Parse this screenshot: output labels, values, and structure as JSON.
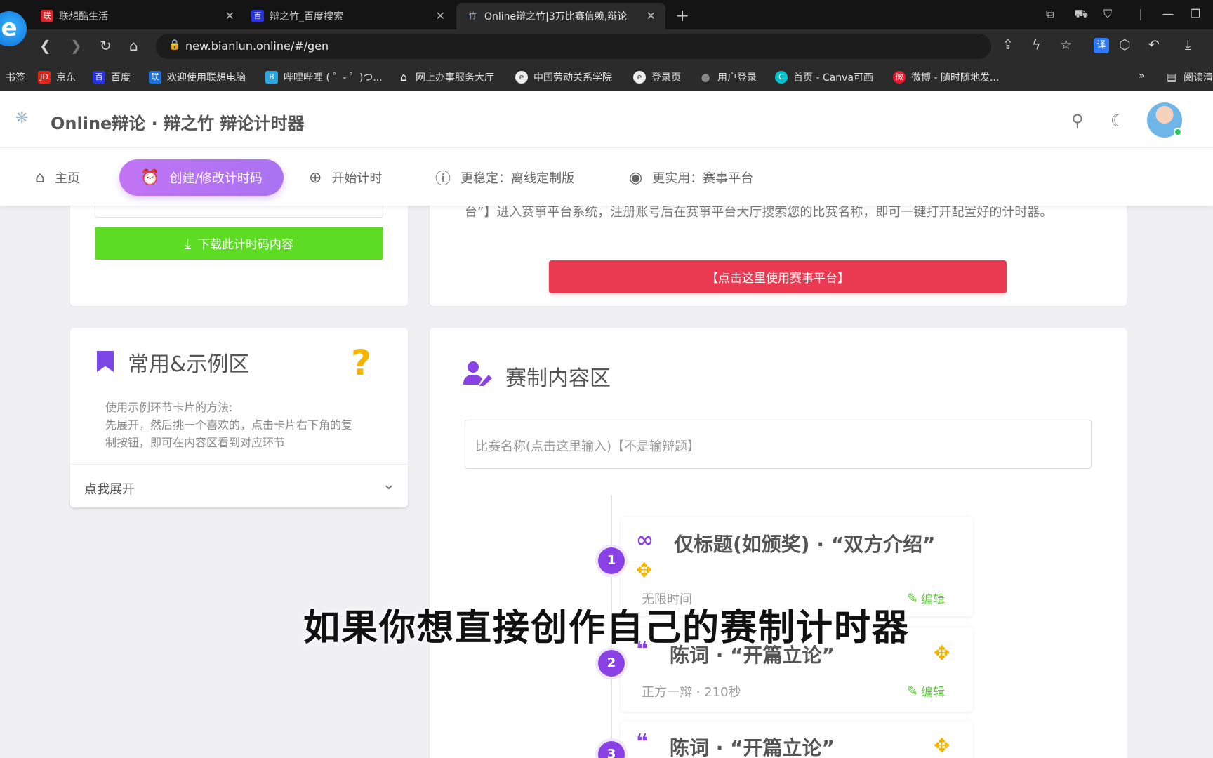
{
  "browser": {
    "tabs": [
      {
        "title": "联想酷生活",
        "favicon": "联"
      },
      {
        "title": "辩之竹_百度搜索",
        "favicon": "百"
      },
      {
        "title": "Online辩之竹|3万比赛信赖,辩论",
        "favicon": "竹"
      }
    ],
    "url": "new.bianlun.online/#/gen",
    "ext_label": "译",
    "bookmarks": [
      {
        "label": "书签"
      },
      {
        "label": "京东",
        "icon": "JD",
        "color": "#e1251b"
      },
      {
        "label": "百度",
        "icon": "百",
        "color": "#2932e1"
      },
      {
        "label": "欢迎使用联想电脑",
        "icon": "联",
        "color": "#1e6fd9"
      },
      {
        "label": "哔哩哔哩 ( ゜- ゜)つ...",
        "icon": "B",
        "color": "#2aa6e0"
      },
      {
        "label": "网上办事服务大厅",
        "icon": "⌂",
        "color": "#666"
      },
      {
        "label": "中国劳动关系学院",
        "icon": "e",
        "color": "#444"
      },
      {
        "label": "登录页",
        "icon": "e",
        "color": "#444"
      },
      {
        "label": "用户登录",
        "icon": "●",
        "color": "#555"
      },
      {
        "label": "首页 - Canva可画",
        "icon": "C",
        "color": "#00c4cc"
      },
      {
        "label": "微博 - 随时随地发...",
        "icon": "微",
        "color": "#e6162d"
      }
    ],
    "bookmarks_more": "»",
    "reader": "阅读清"
  },
  "site": {
    "title": "Online辩论 · 辩之竹 辩论计时器",
    "nav": [
      {
        "label": "主页",
        "icon": "home-icon"
      },
      {
        "label": "创建/修改计时码",
        "icon": "alarm-plus-icon"
      },
      {
        "label": "开始计时",
        "icon": "login-icon"
      },
      {
        "label": "更稳定：离线定制版",
        "icon": "info-circle-icon"
      },
      {
        "label": "更实用：赛事平台",
        "icon": "platform-icon"
      }
    ]
  },
  "main": {
    "download_label": "下载此计时码内容",
    "platform_desc": "台”】进入赛事平台系统，注册账号后在赛事平台大厅搜索您的比赛名称，即可一键打开配置好的计时器。",
    "platform_button": "【点击这里使用赛事平台】",
    "examples": {
      "title": "常用&示例区",
      "qmark": "?",
      "usage_lines": [
        "使用示例环节卡片的方法:",
        "先展开，然后挑一个喜欢的，点击卡片右下角的复",
        "制按钮，即可在内容区看到对应环节"
      ],
      "expand_label": "点我展开"
    },
    "content": {
      "title": "赛制内容区",
      "match_placeholder": "比赛名称(点击这里输入)【不是输辩题】",
      "items": [
        {
          "num": "1",
          "title": "仅标题(如颁奖) · “双方介绍”",
          "sub": "无限时间",
          "edit": "编辑"
        },
        {
          "num": "2",
          "title": "陈词 · “开篇立论”",
          "sub": "正方一辩 · 210秒",
          "edit": "编辑"
        },
        {
          "num": "3",
          "title": "陈词 · “开篇立论”"
        }
      ]
    }
  },
  "subtitle": "如果你想直接创作自己的赛制计时器"
}
